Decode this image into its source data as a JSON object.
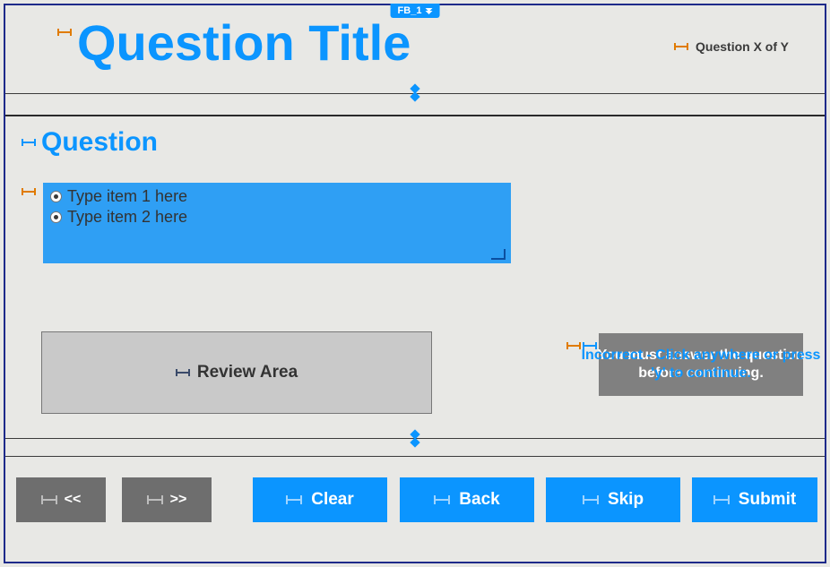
{
  "slide": {
    "name": "FB_1"
  },
  "header": {
    "title": "Question Title",
    "counter": "Question X of Y"
  },
  "question": {
    "label": "Question"
  },
  "answers": {
    "items": [
      {
        "text": "Type item 1 here"
      },
      {
        "text": "Type item 2 here"
      }
    ]
  },
  "review": {
    "label": "Review Area"
  },
  "feedback": {
    "front": "Incorrect - Click anywhere or press 'y' to continue.",
    "back": "You must answer the question before continuing."
  },
  "footer": {
    "prev": "<<",
    "next": ">>",
    "clear": "Clear",
    "back": "Back",
    "skip": "Skip",
    "submit": "Submit"
  },
  "colors": {
    "accent": "#0b95ff",
    "frame": "#1e2a8a",
    "answersBg": "#2f9ff4",
    "reviewBg": "#c9c9c9",
    "feedbackBg": "#808080",
    "navBg": "#6e6e6e"
  }
}
